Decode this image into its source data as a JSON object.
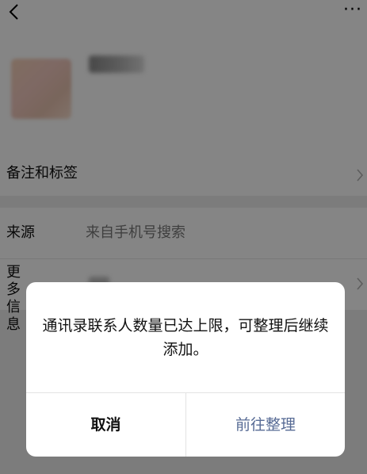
{
  "header": {
    "back_icon": "chevron-left-icon",
    "more_icon": "more-horizontal-icon",
    "more_glyph": "···"
  },
  "rows": {
    "remark_label": "备注和标签",
    "source_label": "来源",
    "source_value": "来自手机号搜索",
    "more_info_label": "更多信息"
  },
  "dialog": {
    "message": "通讯录联系人数量已达上限，可整理后继续添加。",
    "cancel_label": "取消",
    "confirm_label": "前往整理"
  },
  "colors": {
    "confirm_text": "#576b95",
    "overlay": "rgba(0,0,0,0.48)"
  }
}
